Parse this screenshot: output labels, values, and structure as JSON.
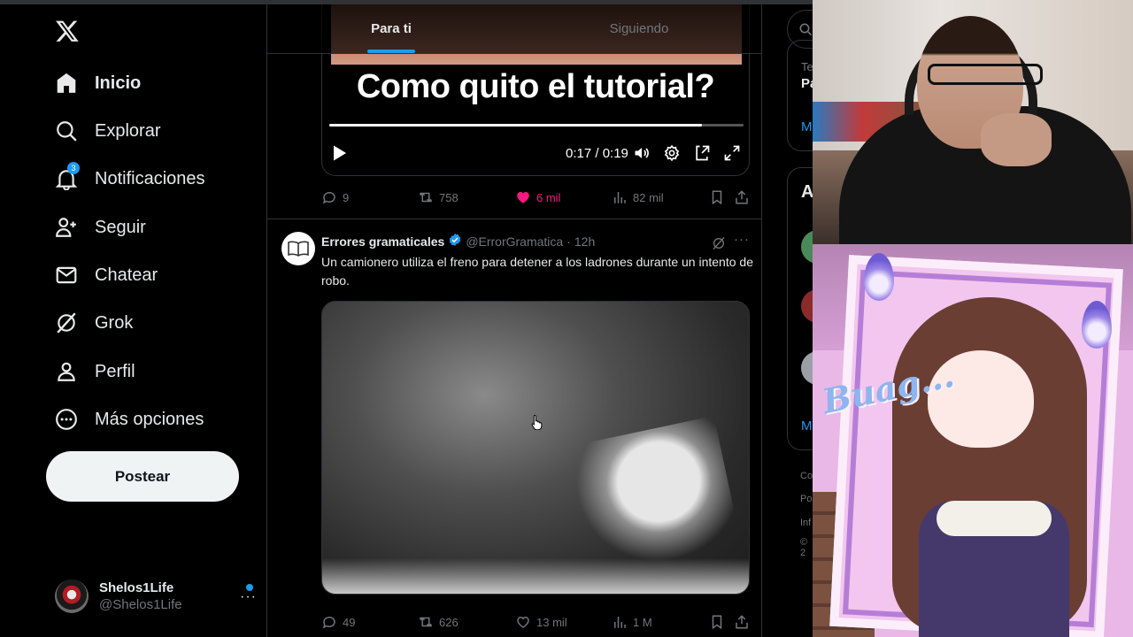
{
  "sidebar": {
    "nav": [
      {
        "label": "Inicio",
        "icon": "home-icon"
      },
      {
        "label": "Explorar",
        "icon": "search-icon"
      },
      {
        "label": "Notificaciones",
        "icon": "bell-icon",
        "badge": "3"
      },
      {
        "label": "Seguir",
        "icon": "follow-icon"
      },
      {
        "label": "Chatear",
        "icon": "mail-icon"
      },
      {
        "label": "Grok",
        "icon": "grok-icon"
      },
      {
        "label": "Perfil",
        "icon": "profile-icon"
      },
      {
        "label": "Más opciones",
        "icon": "more-icon"
      }
    ],
    "post_button": "Postear",
    "account": {
      "name": "Shelos1Life",
      "handle": "@Shelos1Life"
    }
  },
  "feed": {
    "tabs": [
      {
        "label": "Para ti"
      },
      {
        "label": "Siguiendo"
      }
    ],
    "tweet1": {
      "video_caption": "Como quito el tutorial?",
      "time": "0:17 / 0:19",
      "progress": 0.9,
      "replies": "9",
      "reposts": "758",
      "likes": "6 mil",
      "views": "82 mil"
    },
    "tweet2": {
      "name": "Errores gramaticales",
      "handle": "@ErrorGramatica",
      "sep": "·",
      "time": "12h",
      "text": "Un camionero utiliza el freno para detener a los ladrones durante un intento de robo.",
      "replies": "49",
      "reposts": "626",
      "likes": "13 mil",
      "views": "1 M"
    }
  },
  "right": {
    "trend_small": "Te",
    "trend_strong": "Pa",
    "link1": "M",
    "who_title": "A",
    "link2": "M",
    "footer": [
      "Co",
      "Po",
      "Inf",
      "© 2"
    ]
  },
  "overlay": {
    "vtuber_text": "Buag..."
  },
  "colors": {
    "accent": "#1d9bf0",
    "like": "#f91880",
    "background": "#000000",
    "border": "#2f3336",
    "muted": "#71767b"
  }
}
